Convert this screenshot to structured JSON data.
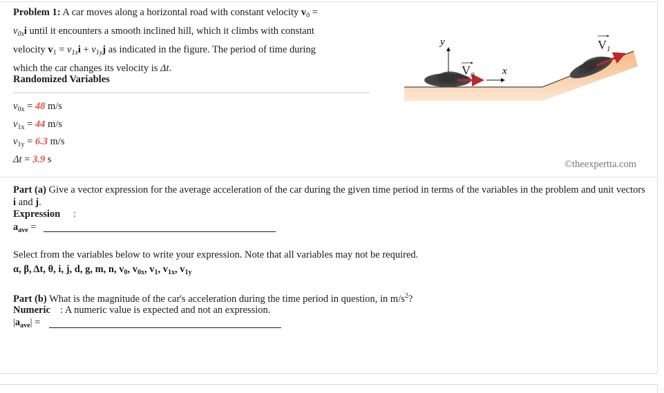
{
  "problem": {
    "label": "Problem 1:",
    "line1": " A car moves along a horizontal road with constant velocity ",
    "v0_bold": "v",
    "v0_sub": "0",
    "eq1": " =",
    "line2_var": "v",
    "line2_sub": "0x",
    "line2_i": "i",
    "line2_rest": " until it encounters a smooth inclined hill, which it climbs with constant",
    "line3_pre": "velocity ",
    "v1_bold": "v",
    "v1_sub": "1",
    "line3_eq": " = ",
    "v1x": "v",
    "v1x_sub": "1x",
    "i": "i",
    "plus": " + ",
    "v1y": "v",
    "v1y_sub": "1y",
    "j": "j",
    "line3_rest": " as indicated in the figure. The period of time during",
    "line4": "which the car changes its velocity is ",
    "dt": "Δt",
    "period": "."
  },
  "randomized_variables": {
    "title": "Randomized Variables",
    "items": [
      {
        "var": "v",
        "sub": "0x",
        "eq": " = ",
        "value": "48",
        "unit": " m/s"
      },
      {
        "var": "v",
        "sub": "1x",
        "eq": " = ",
        "value": "44",
        "unit": " m/s"
      },
      {
        "var": "v",
        "sub": "1y",
        "eq": " = ",
        "value": "6.3",
        "unit": " m/s"
      },
      {
        "var": "Δt",
        "sub": "",
        "eq": " = ",
        "value": "3.9",
        "unit": " s"
      }
    ]
  },
  "figure": {
    "y_label": "y",
    "x_label": "x",
    "v0_label": "V",
    "v0_sub": "0",
    "v1_label": "V",
    "v1_sub": "1",
    "colors": {
      "ground": "#f7c69a",
      "arrow": "#b8282c",
      "car": "#3a3a3a"
    }
  },
  "copyright": "©theexpertta.com",
  "part_a": {
    "label": "Part (a)",
    "text": " Give a vector expression for the average acceleration of the car during the given time period in terms of the variables in the problem and unit vectors ",
    "i": "i",
    "and": " and ",
    "j": "j",
    "end": ".",
    "expression_label": "Expression",
    "colon": ":",
    "answer_var": "a",
    "answer_sub": "ave",
    "answer_eq": " =",
    "select_text": "Select from the variables below to write your expression. Note that all variables may not be required.",
    "variables": "α, β, Δt, θ, i, j, d, g, m, n, ",
    "variables_sub": [
      {
        "v": "v",
        "s": "0",
        "sep": ", "
      },
      {
        "v": "v",
        "s": "0x",
        "sep": ", "
      },
      {
        "v": "v",
        "s": "1",
        "sep": ", "
      },
      {
        "v": "v",
        "s": "1x",
        "sep": ", "
      },
      {
        "v": "v",
        "s": "1y",
        "sep": ""
      }
    ]
  },
  "part_b": {
    "label": "Part (b)",
    "text": " What is the magnitude of the car's acceleration during the time period in question, in m/s",
    "sup": "2",
    "end": "?",
    "numeric_label": "Numeric",
    "numeric_desc": ": A numeric value is expected and not an expression.",
    "answer_pre": "|",
    "answer_var": "a",
    "answer_sub": "ave",
    "answer_post": "|",
    "answer_eq": " ="
  }
}
